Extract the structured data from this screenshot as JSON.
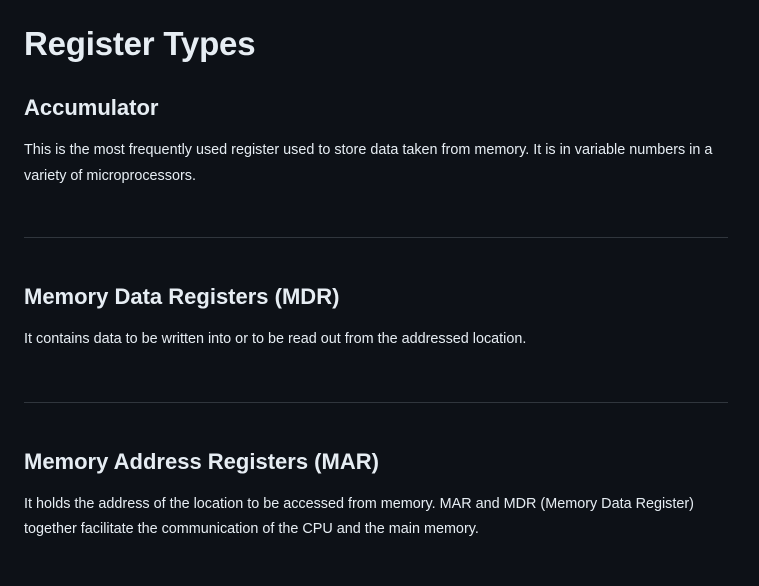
{
  "page": {
    "title": "Register Types"
  },
  "sections": [
    {
      "heading": "Accumulator",
      "body": "This is the most frequently used register used to store data taken from memory. It is in variable numbers in a variety of microprocessors."
    },
    {
      "heading": "Memory Data Registers (MDR)",
      "body": "It contains data to be written into or to be read out from the addressed location."
    },
    {
      "heading": "Memory Address Registers (MAR)",
      "body": "It holds the address of the location to be accessed from memory. MAR and MDR (Memory Data Register) together facilitate the communication of the CPU and the main memory."
    }
  ]
}
